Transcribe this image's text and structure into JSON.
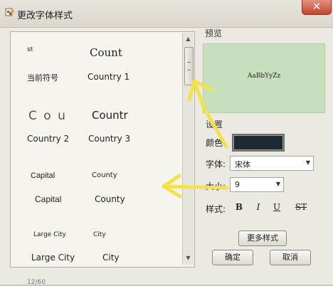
{
  "window": {
    "title": "更改字体样式",
    "close_glyph": "✕"
  },
  "font_list": {
    "samples": [
      {
        "text": "st"
      },
      {
        "text": "Count"
      },
      {
        "text": "当前符号"
      },
      {
        "text": "Country 1"
      },
      {
        "text": "C o u"
      },
      {
        "text": "Countr"
      },
      {
        "text": "Country 2"
      },
      {
        "text": "Country 3"
      },
      {
        "text": "Capital"
      },
      {
        "text": "County"
      },
      {
        "text": "Capital"
      },
      {
        "text": "County"
      },
      {
        "text": "Large City"
      },
      {
        "text": "City"
      },
      {
        "text": "Large City"
      },
      {
        "text": "City"
      }
    ],
    "scroll_up_glyph": "▲",
    "scroll_down_glyph": "▼"
  },
  "preview": {
    "label": "预览",
    "sample_text": "AaBbYyZz",
    "background": "#c7dfbc"
  },
  "settings": {
    "label": "设置",
    "color_label": "颜色:",
    "color_value": "#1c2a30",
    "font_label": "字体:",
    "font_value": "宋体",
    "size_label": "大小:",
    "size_value": "9",
    "style_label": "样式:",
    "bold_label": "B",
    "italic_label": "I",
    "underline_label": "U",
    "strike_label": "ST",
    "combo_arrow": "▼"
  },
  "buttons": {
    "more_styles": "更多样式",
    "ok": "确定",
    "cancel": "取消"
  },
  "status_text": "12/60",
  "annotations": {
    "color": "#f2e24c"
  }
}
